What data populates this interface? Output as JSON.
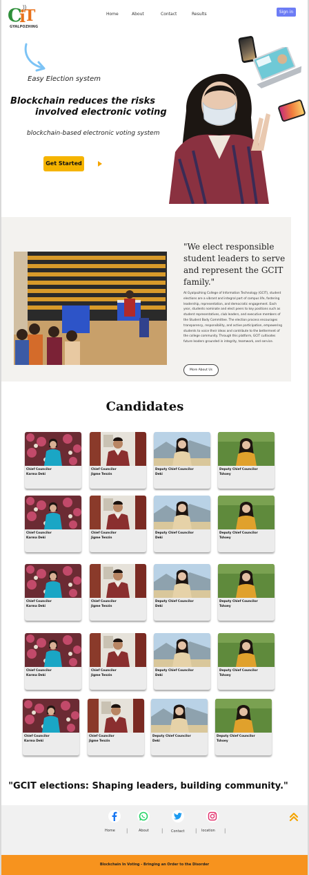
{
  "header": {
    "logo_text": "GYALPOZHING",
    "nav": [
      "Home",
      "About",
      "Contact",
      "Results"
    ],
    "signin_label": "Sign in"
  },
  "hero": {
    "tagline": "Easy Election system",
    "title_line1": "Blockchain reduces the risks",
    "title_line2": "involved  electronic voting",
    "subtitle": "blockchain-based electronic voting system",
    "cta_label": "Get Started"
  },
  "about": {
    "quote_lines": [
      "\"We elect responsible",
      "student leaders to serve",
      "and represent the GCIT",
      "family.\""
    ],
    "body": "At Gyalpozhing College of Information Technology (GCIT), student elections are a vibrant and integral part of campus life, fostering leadership, representation, and democratic engagement. Each year, students nominate and elect peers to key positions such as student representatives, club leaders, and executive members of the Student Body Committee. The election process encourages transparency, responsibility, and active participation, empowering students to voice their ideas and contribute to the betterment of the college community. Through this platform, GCIT cultivates future leaders grounded in integrity, teamwork, and service.",
    "more_label": "More About Us"
  },
  "candidates": {
    "title": "Candidates",
    "cards": [
      {
        "role": "Chief Councilor",
        "name": "Karma Deki",
        "photo": "karma"
      },
      {
        "role": "Chief Councilor",
        "name": "Jigme Tenzin",
        "photo": "jigme"
      },
      {
        "role": "Deputy Chief Councilor",
        "name": "Deki",
        "photo": "deki"
      },
      {
        "role": "Deputy Chief Councilor",
        "name": "Tshoey",
        "photo": "tshoey"
      }
    ]
  },
  "slogan": "\"GCIT elections: Shaping leaders, building community.\"",
  "footer": {
    "links": [
      "Home",
      "About",
      "Contact",
      "location"
    ],
    "bottom_text": "Blockchain In Voting - Bringing an Order to the Disorder",
    "colors": {
      "bar": "#f7931e",
      "cta": "#f5b400",
      "signin": "#6c7cf5"
    }
  }
}
